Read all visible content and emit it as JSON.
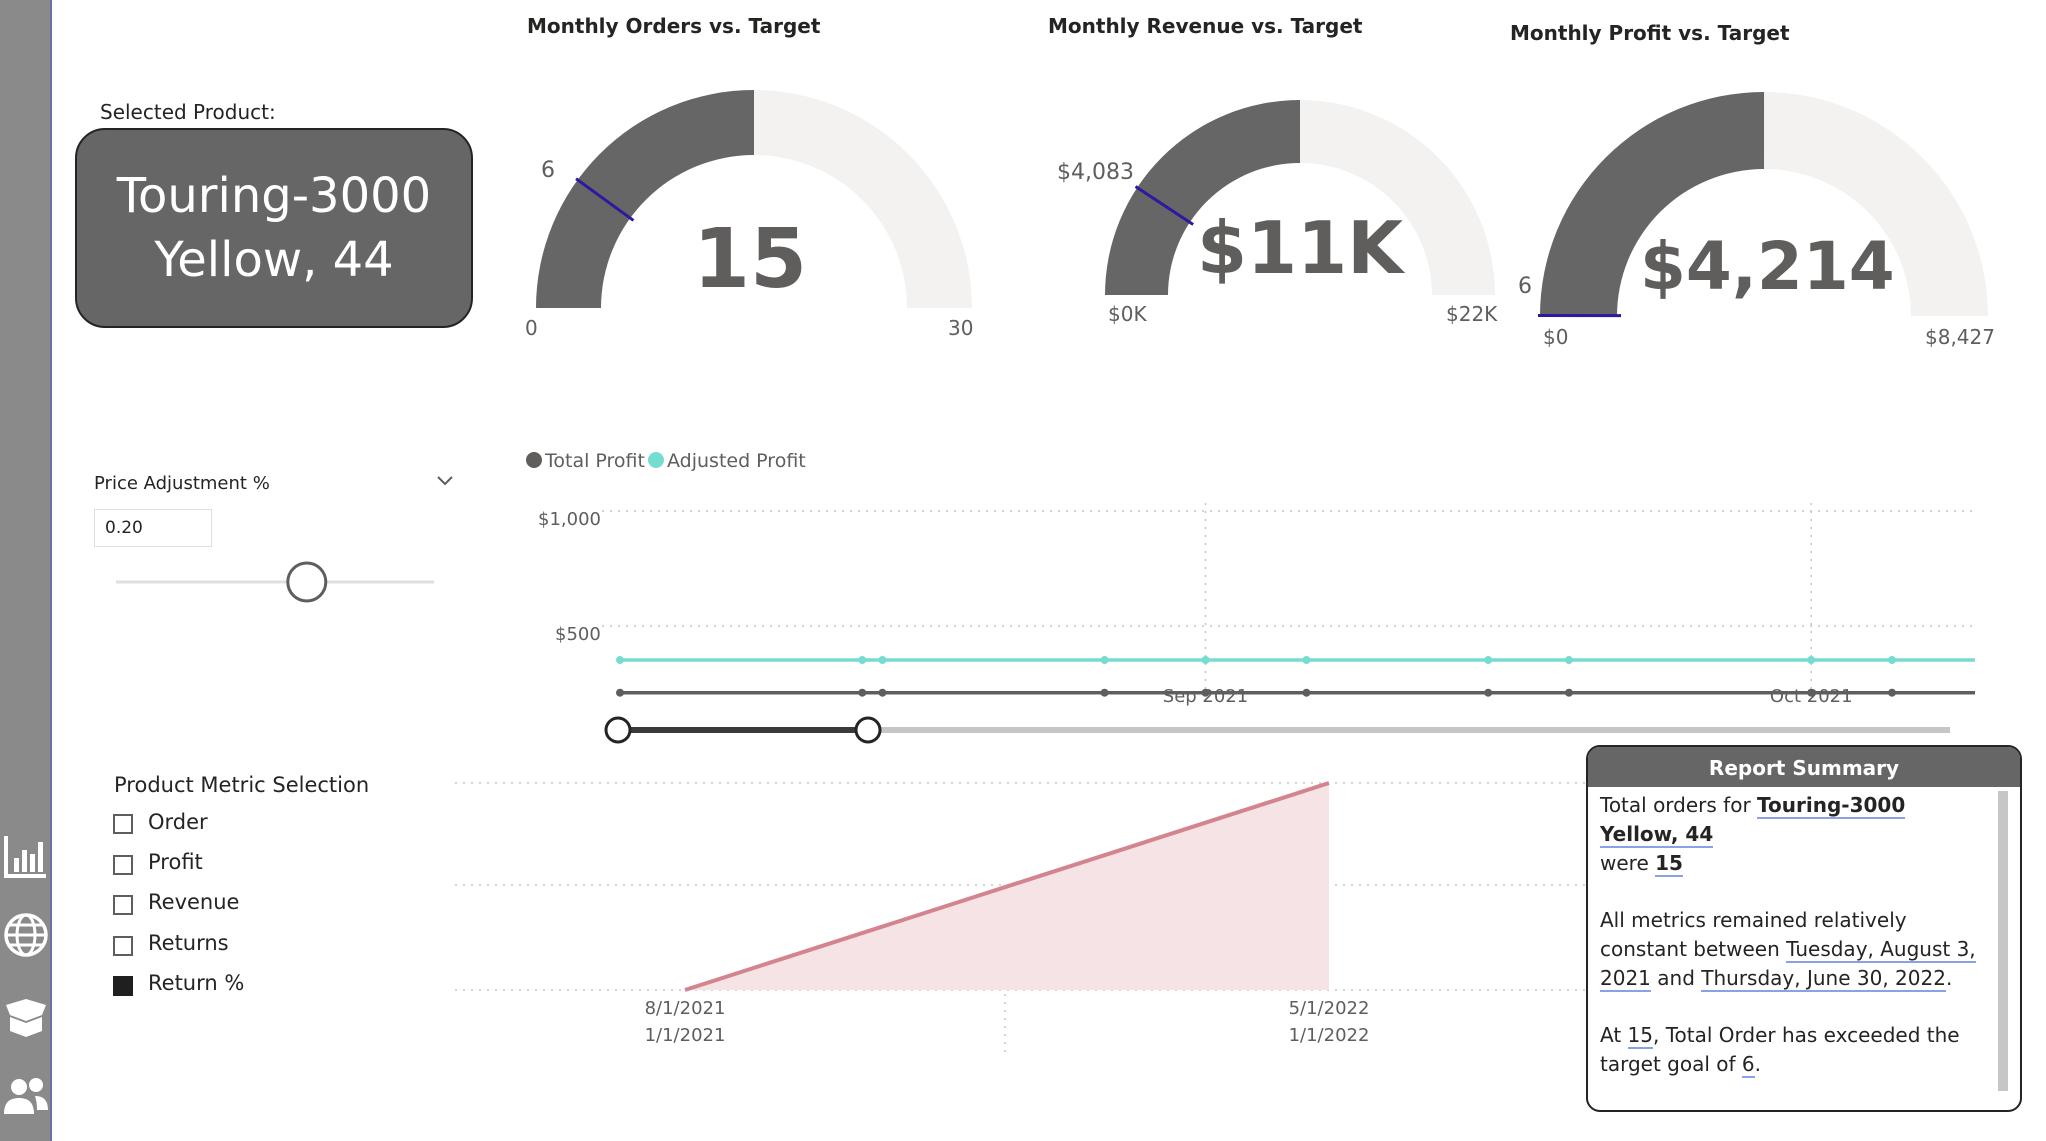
{
  "nav": {
    "items": [
      {
        "name": "analytics-icon"
      },
      {
        "name": "globe-icon"
      },
      {
        "name": "package-icon"
      },
      {
        "name": "users-icon"
      }
    ]
  },
  "selected_product": {
    "label": "Selected Product:",
    "line1": "Touring-3000",
    "line2": "Yellow, 44"
  },
  "gauges": {
    "orders": {
      "title": "Monthly Orders vs. Target",
      "value_label": "15",
      "min_label": "0",
      "max_label": "30",
      "target_label": "6",
      "value": 15,
      "min": 0,
      "max": 30,
      "target": 6
    },
    "revenue": {
      "title": "Monthly Revenue vs. Target",
      "value_label": "$11K",
      "min_label": "$0K",
      "max_label": "$22K",
      "target_label": "$4,083",
      "value": 11000,
      "min": 0,
      "max": 22000,
      "target": 4083
    },
    "profit": {
      "title": "Monthly Profit vs. Target",
      "value_label": "$4,214",
      "min_label": "$0",
      "max_label": "$8,427",
      "target_label": "6",
      "value": 4214,
      "min": 0,
      "max": 8427,
      "target": 6
    }
  },
  "price_adjustment": {
    "label": "Price Adjustment %",
    "value": "0.20",
    "slider_position": 0.6
  },
  "metric_selection": {
    "title": "Product Metric Selection",
    "options": [
      {
        "label": "Order",
        "checked": false
      },
      {
        "label": "Profit",
        "checked": false
      },
      {
        "label": "Revenue",
        "checked": false
      },
      {
        "label": "Returns",
        "checked": false
      },
      {
        "label": "Return %",
        "checked": true
      }
    ]
  },
  "chart_data": [
    {
      "type": "line",
      "title": "",
      "legend_position": "top-left",
      "y_ticks": [
        "$1,000",
        "$500"
      ],
      "ylim": [
        0,
        1000
      ],
      "x_ticks": [
        "Sep 2021",
        "Oct 2021"
      ],
      "x": [
        "2021-08-03",
        "2021-08-15",
        "2021-08-16",
        "2021-08-27",
        "2021-09-01",
        "2021-09-06",
        "2021-09-15",
        "2021-09-19",
        "2021-10-01",
        "2021-10-05"
      ],
      "series": [
        {
          "name": "Total Profit",
          "color": "#605e5c",
          "values": [
            355,
            355,
            355,
            355,
            355,
            355,
            355,
            355,
            355,
            355
          ]
        },
        {
          "name": "Adjusted Profit",
          "color": "#76dcd0",
          "values": [
            426,
            426,
            426,
            426,
            426,
            426,
            426,
            426,
            426,
            426
          ]
        }
      ],
      "grid": true
    },
    {
      "type": "area",
      "title": "",
      "x_ticks": [
        {
          "line1": "8/1/2021",
          "line2": "1/1/2021"
        },
        {
          "line1": "5/1/2022",
          "line2": "1/1/2022"
        }
      ],
      "series": [
        {
          "name": "",
          "color": "#d4848e",
          "values": [
            0,
            1
          ]
        }
      ],
      "grid": true
    }
  ],
  "date_slider": {
    "start_fraction": 0.0,
    "end_fraction": 0.188
  },
  "report_summary": {
    "title": "Report Summary",
    "p1_a": "Total orders for ",
    "p1_product": "Touring-3000 Yellow, 44",
    "p1_b": "were ",
    "p1_value": "15",
    "p2_a": "All metrics remained relatively constant between ",
    "p2_start": "Tuesday, August 3, 2021",
    "p2_b": " and ",
    "p2_end": "Thursday, June 30, 2022",
    "p2_c": ".",
    "p3_a": "At ",
    "p3_value": "15",
    "p3_b": ", Total Order has exceeded the target goal of ",
    "p3_target": "6",
    "p3_c": "."
  }
}
